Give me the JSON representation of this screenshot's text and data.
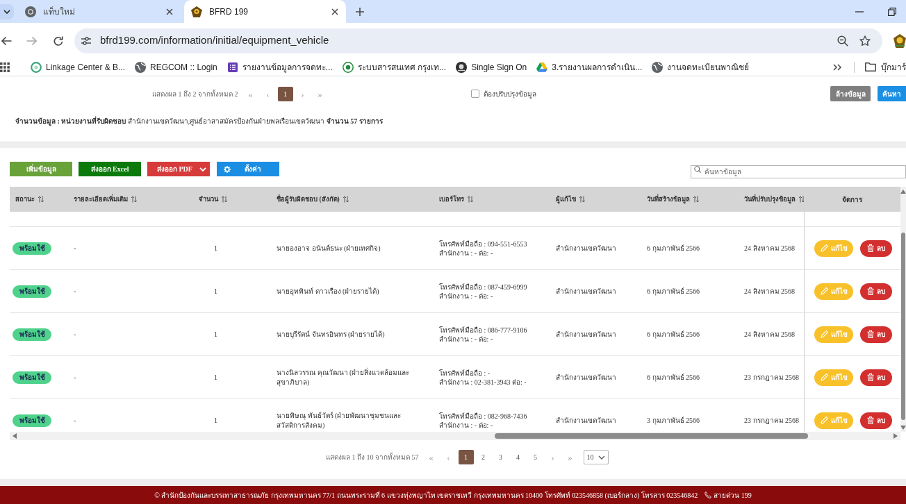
{
  "browser": {
    "tabs": [
      {
        "title": "แท็บใหม่",
        "kind": "newtab",
        "selected": false
      },
      {
        "title": "BFRD 199",
        "kind": "site",
        "selected": true
      }
    ],
    "url": "bfrd199.com/information/initial/equipment_vehicle",
    "bookmarks": [
      {
        "label": "Linkage Center & B...",
        "kind": "ring"
      },
      {
        "label": "REGCOM :: Login",
        "kind": "globe"
      },
      {
        "label": "รายงานข้อมูลการจดทะ...",
        "kind": "form"
      },
      {
        "label": "ระบบสารสนเทศ กรุงเท...",
        "kind": "seal"
      },
      {
        "label": "Single Sign On",
        "kind": "emblem"
      },
      {
        "label": "3.รายงานผลการดำเนิน...",
        "kind": "drive"
      },
      {
        "label": "งานจดทะเบียนพาณิชย์",
        "kind": "globe"
      }
    ],
    "bookmark_folder": "บุ๊กมาร์"
  },
  "filter_panel": {
    "pager": {
      "summary": "แสดงผล 1 ถึง 2 จากทั้งหมด 2",
      "first": "«",
      "prev": "‹",
      "pages": [
        {
          "label": "1",
          "selected": true
        }
      ],
      "next": "›",
      "last": "»"
    },
    "needs_update": {
      "label": "ต้องปรับปรุงข้อมูล",
      "checked": false
    },
    "buttons": [
      {
        "label": "ล้างข้อมูล",
        "kind": "clear"
      },
      {
        "label": "ค้นหา",
        "kind": "search"
      }
    ],
    "summary": "**จำนวนข้อมูล :  หน่วยงานที่รับผิดชอบ** สำนักงานเขตวัฒนา,ศูนย์อาสาสมัครป้องกันฝ่ายพลเรือนเขตวัฒนา  **จำนวน 57 รายการ**"
  },
  "toolbar": {
    "buttons": [
      {
        "label": "เพิ่มข้อมูล",
        "kind": "add"
      },
      {
        "label": "ส่งออก Excel",
        "kind": "excel"
      },
      {
        "label": "ส่งออก PDF",
        "kind": "pdf"
      },
      {
        "label": "ตั้งค่า",
        "kind": "settings"
      }
    ],
    "search": {
      "placeholder": "ค้นหาข้อมูล"
    }
  },
  "table": {
    "columns": [
      {
        "label": "สถานะ",
        "sortable": true
      },
      {
        "label": "รายละเอียดเพิ่มเติม",
        "sortable": true
      },
      {
        "label": "จำนวน",
        "sortable": true
      },
      {
        "label": "ชื่อผู้รับผิดชอบ (สังกัด)",
        "sortable": true
      },
      {
        "label": "เบอร์โทร",
        "sortable": true
      },
      {
        "label": "ผู้แก้ไข",
        "sortable": true
      },
      {
        "label": "วันที่สร้างข้อมูล",
        "sortable": true
      },
      {
        "label": "วันที่ปรับปรุงข้อมูล",
        "sortable": true
      },
      {
        "label": "จัดการ",
        "sortable": false
      }
    ],
    "rows": [
      {
        "status": "พร้อมใช้",
        "detail": "-",
        "quantity": "1",
        "responsible": "นายองอาจ อนันต์ธนะ (ฝ่ายเทศกิจ)",
        "phone_mobile": "โทรศัพท์มือถือ : 094-551-6553",
        "phone_office": "สำนักงาน : - ต่อ: -",
        "editor": "สำนักงานเขตวัฒนา",
        "created": "6 กุมภาพันธ์ 2566",
        "updated": "24 สิงหาคม 2568",
        "actions": [
          {
            "label": "แก้ไข",
            "kind": "edit"
          },
          {
            "label": "ลบ",
            "kind": "delete"
          }
        ]
      },
      {
        "status": "พร้อมใช้",
        "detail": "-",
        "quantity": "1",
        "responsible": "นายอุทพินท์ ดาวเรือง (ฝ่ายรายได้)",
        "phone_mobile": "โทรศัพท์มือถือ : 087-459-6999",
        "phone_office": "สำนักงาน : - ต่อ: -",
        "editor": "สำนักงานเขตวัฒนา",
        "created": "6 กุมภาพันธ์ 2566",
        "updated": "24 สิงหาคม 2568",
        "actions": [
          {
            "label": "แก้ไข",
            "kind": "edit"
          },
          {
            "label": "ลบ",
            "kind": "delete"
          }
        ]
      },
      {
        "status": "พร้อมใช้",
        "detail": "-",
        "quantity": "1",
        "responsible": "นายบุรีรัตน์ จันทรอินทร (ฝ่ายรายได้)",
        "phone_mobile": "โทรศัพท์มือถือ : 086-777-9106",
        "phone_office": "สำนักงาน : - ต่อ: -",
        "editor": "สำนักงานเขตวัฒนา",
        "created": "6 กุมภาพันธ์ 2566",
        "updated": "24 สิงหาคม 2568",
        "actions": [
          {
            "label": "แก้ไข",
            "kind": "edit"
          },
          {
            "label": "ลบ",
            "kind": "delete"
          }
        ]
      },
      {
        "status": "พร้อมใช้",
        "detail": "-",
        "quantity": "1",
        "responsible": "นางนิลวรรณ คุณวัฒนา (ฝ่ายสิ่งแวดล้อมและสุขาภิบาล)",
        "phone_mobile": "โทรศัพท์มือถือ : -",
        "phone_office": "สำนักงาน : 02-381-3943 ต่อ: -",
        "editor": "สำนักงานเขตวัฒนา",
        "created": "6 กุมภาพันธ์ 2566",
        "updated": "23 กรกฎาคม 2568",
        "actions": [
          {
            "label": "แก้ไข",
            "kind": "edit"
          },
          {
            "label": "ลบ",
            "kind": "delete"
          }
        ]
      },
      {
        "status": "พร้อมใช้",
        "detail": "-",
        "quantity": "1",
        "responsible": "นายพิษณุ พันธ์วัตร์ (ฝ่ายพัฒนาชุมชนและสวัสดิการสังคม)",
        "phone_mobile": "โทรศัพท์มือถือ : 082-968-7436",
        "phone_office": "สำนักงาน : - ต่อ: -",
        "editor": "สำนักงานเขตวัฒนา",
        "created": "3 กุมภาพันธ์ 2566",
        "updated": "23 กรกฎาคม 2568",
        "actions": [
          {
            "label": "แก้ไข",
            "kind": "edit"
          },
          {
            "label": "ลบ",
            "kind": "delete"
          }
        ]
      }
    ]
  },
  "pagination": {
    "summary": "แสดงผล 1 ถึง 10 จากทั้งหมด 57",
    "first": "«",
    "prev": "‹",
    "pages": [
      {
        "label": "1",
        "selected": true
      },
      {
        "label": "2",
        "selected": false
      },
      {
        "label": "3",
        "selected": false
      },
      {
        "label": "4",
        "selected": false
      },
      {
        "label": "5",
        "selected": false
      }
    ],
    "next": "›",
    "last": "»",
    "page_size": "10"
  },
  "footer": {
    "address": "© สำนักป้องกันและบรรเทาสาธารณภัย กรุงเทพมหานคร 77/1 ถนนพระรามที่ 6 แขวงทุ่งพญาไท เขตราชเทวี กรุงเทพมหานคร 10400 โทรศัพท์ 023546858 (เบอร์กลาง) โทรสาร 023546842",
    "hotline": "สายด่วน 199"
  }
}
